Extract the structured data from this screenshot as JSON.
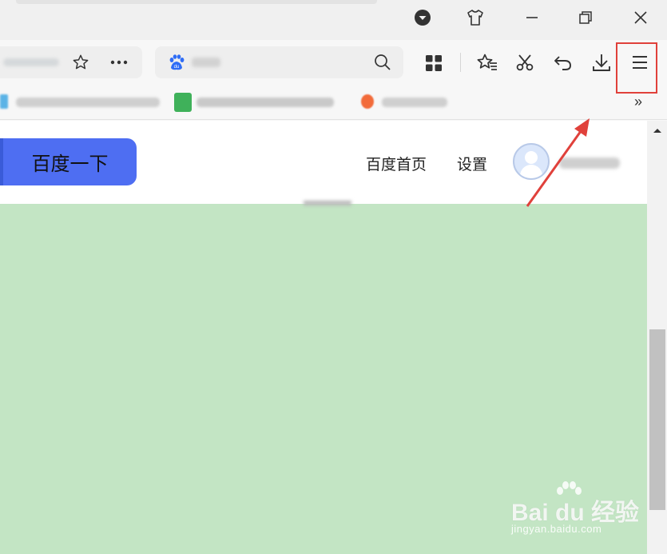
{
  "browser": {
    "window_controls": {
      "dropdown_icon": "circle-down-icon",
      "skin_icon": "tshirt-icon",
      "minimize_icon": "minimize-icon",
      "restore_icon": "restore-icon",
      "close_icon": "close-icon"
    },
    "toolbar": {
      "address_partial_text": "",
      "favorite_icon": "star-icon",
      "more_icon": "more-dots-icon",
      "search_engine_icon": "baidu-paw-icon",
      "search_icon": "search-icon",
      "apps_icon": "grid-icon",
      "favorites_icon": "star-list-icon",
      "screenshot_icon": "scissors-icon",
      "undo_icon": "undo-icon",
      "download_icon": "download-icon",
      "menu_icon": "hamburger-menu-icon"
    },
    "bookmarks": {
      "overflow_label": "»"
    }
  },
  "page": {
    "search_button_label": "百度一下",
    "nav_links": [
      "百度首页",
      "设置"
    ],
    "accent_color": "#4e6ef2",
    "background_color": "#c3e5c4"
  },
  "watermark": {
    "logo": "Bai du 经验",
    "url": "jingyan.baidu.com"
  },
  "annotation": {
    "highlight_color": "#e0413b"
  }
}
